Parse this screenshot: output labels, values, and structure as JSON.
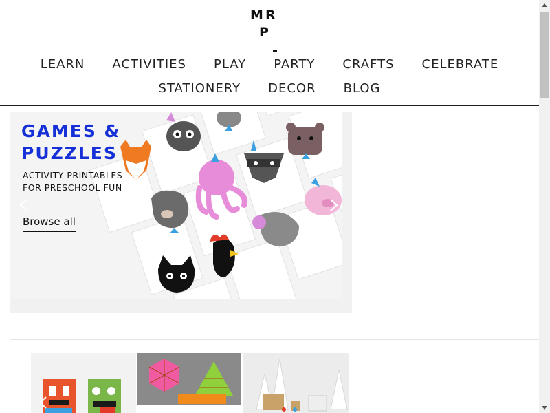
{
  "logo": {
    "alt": "MRP logo",
    "letters": [
      "M",
      "R",
      "P"
    ]
  },
  "nav": {
    "row1": [
      "LEARN",
      "ACTIVITIES",
      "PLAY",
      "PARTY",
      "CRAFTS",
      "CELEBRATE"
    ],
    "row2": [
      "STATIONERY",
      "DECOR",
      "BLOG"
    ]
  },
  "hero": {
    "title_line1": "GAMES &",
    "title_line2": "PUZZLES",
    "subtitle_line1": "ACTIVITY PRINTABLES",
    "subtitle_line2": "FOR PRESCHOOL FUN",
    "link": "Browse all",
    "cards": [
      "THE FOX",
      "THE OWL",
      "THE RABBIT",
      "THE BEAR",
      "THE RACCOON",
      "THE OCTOPUS",
      "THE DOG",
      "THE PIG",
      "THE MOUSE",
      "THE CHICKEN",
      "THE CAT"
    ]
  },
  "colors": {
    "accent": "#1530d6",
    "text": "#222222",
    "rule": "#222222"
  },
  "icons": {
    "prev": "chevron-left-icon",
    "next": "chevron-right-icon"
  }
}
